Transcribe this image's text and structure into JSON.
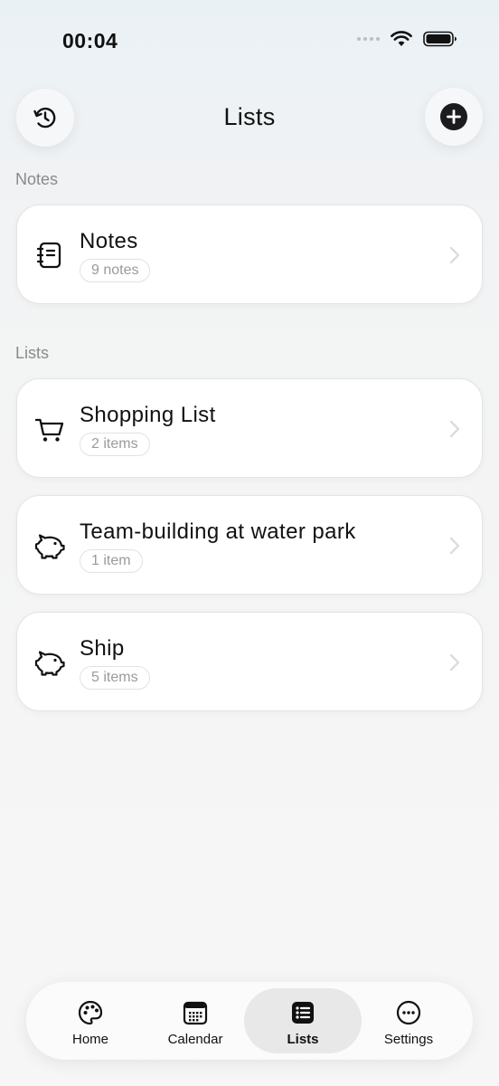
{
  "status_bar": {
    "time": "00:04"
  },
  "header": {
    "title": "Lists"
  },
  "sections": {
    "notes_label": "Notes",
    "lists_label": "Lists"
  },
  "notes_card": {
    "title": "Notes",
    "count": "9 notes",
    "icon": "notebook-icon"
  },
  "lists": [
    {
      "title": "Shopping List",
      "count": "2 items",
      "icon": "shopping-cart-icon"
    },
    {
      "title": "Team-building at water park",
      "count": "1 item",
      "icon": "piggy-bank-icon"
    },
    {
      "title": "Ship",
      "count": "5 items",
      "icon": "piggy-bank-icon"
    }
  ],
  "tabs": [
    {
      "label": "Home",
      "icon": "palette-icon",
      "active": false
    },
    {
      "label": "Calendar",
      "icon": "calendar-icon",
      "active": false
    },
    {
      "label": "Lists",
      "icon": "list-icon",
      "active": true
    },
    {
      "label": "Settings",
      "icon": "more-icon",
      "active": false
    }
  ],
  "colors": {
    "active_tab_bg": "#e8e8e8",
    "text": "#111111",
    "muted": "#8a8a8a"
  }
}
